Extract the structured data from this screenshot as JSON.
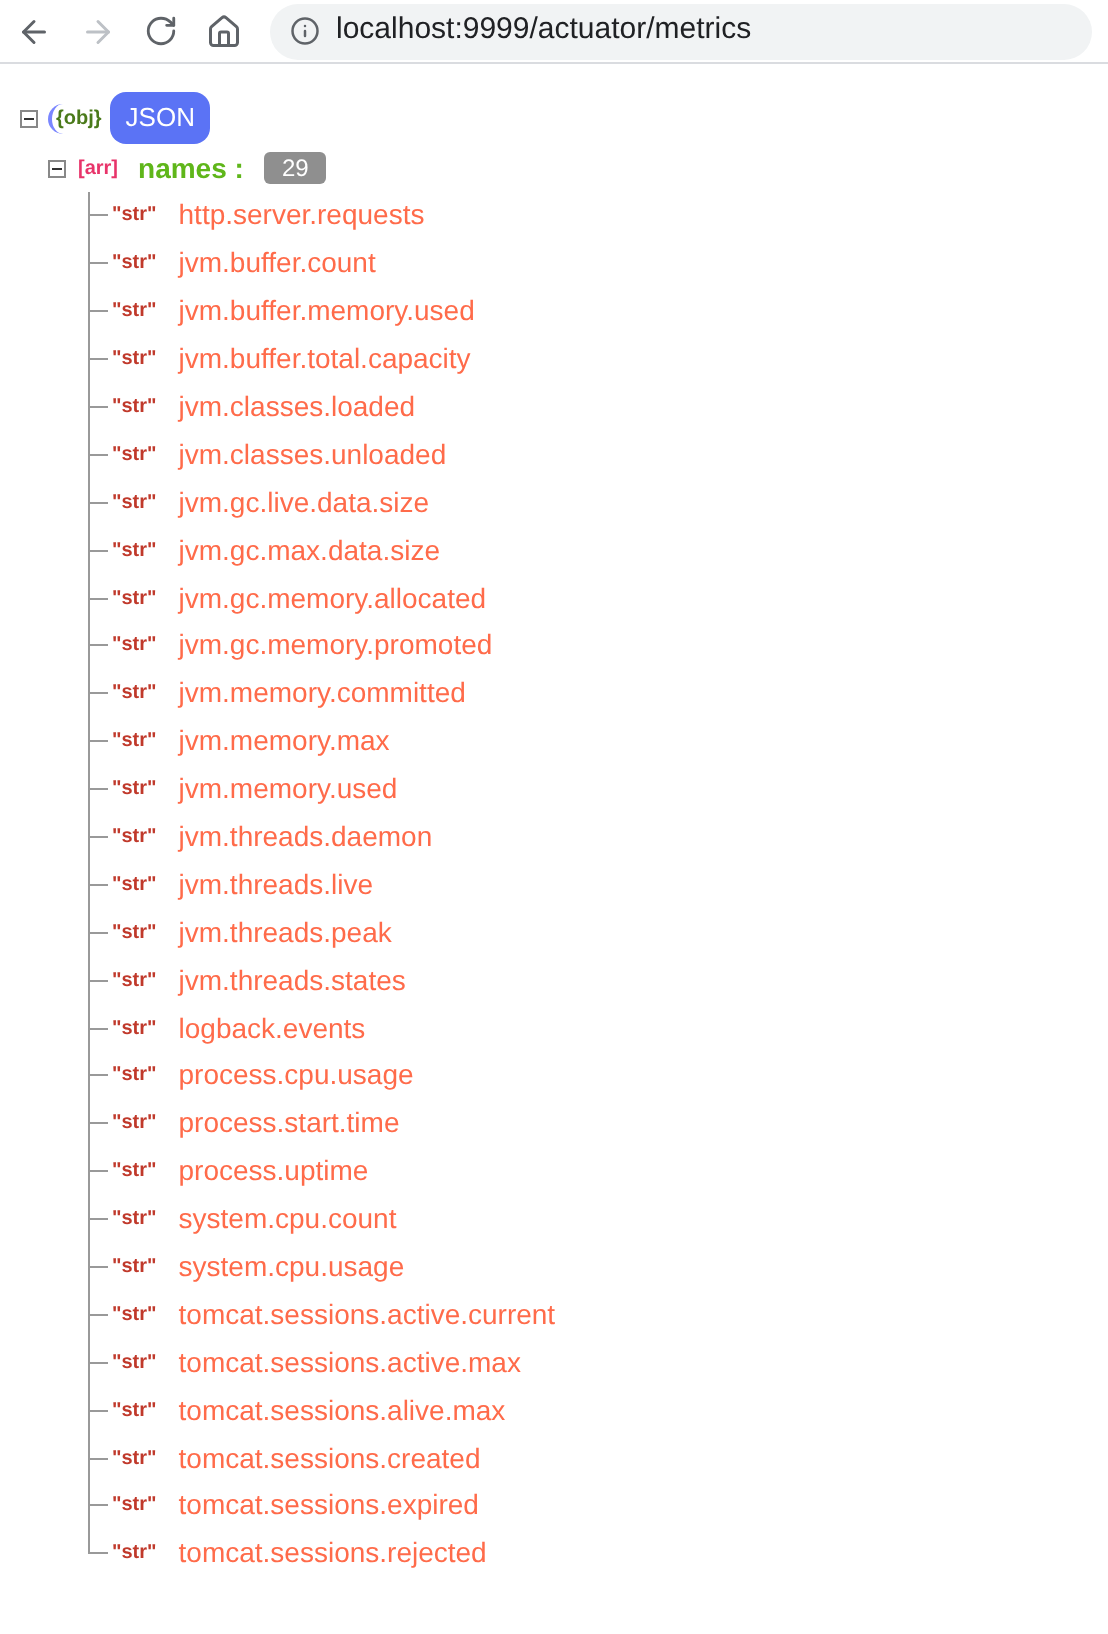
{
  "browser": {
    "url": "localhost:9999/actuator/metrics"
  },
  "tree": {
    "type_tag": "{obj}",
    "label": "JSON",
    "expanded": true,
    "children": [
      {
        "type_tag": "[arr]",
        "key": "names :",
        "count": "29",
        "expanded": true,
        "children": [
          {
            "type_tag": "\"str\"",
            "value": "http.server.requests"
          },
          {
            "type_tag": "\"str\"",
            "value": "jvm.buffer.count"
          },
          {
            "type_tag": "\"str\"",
            "value": "jvm.buffer.memory.used"
          },
          {
            "type_tag": "\"str\"",
            "value": "jvm.buffer.total.capacity"
          },
          {
            "type_tag": "\"str\"",
            "value": "jvm.classes.loaded"
          },
          {
            "type_tag": "\"str\"",
            "value": "jvm.classes.unloaded"
          },
          {
            "type_tag": "\"str\"",
            "value": "jvm.gc.live.data.size"
          },
          {
            "type_tag": "\"str\"",
            "value": "jvm.gc.max.data.size"
          },
          {
            "type_tag": "\"str\"",
            "value": "jvm.gc.memory.allocated"
          },
          {
            "type_tag": "\"str\"",
            "value": "jvm.gc.memory.promoted"
          },
          {
            "type_tag": "\"str\"",
            "value": "jvm.memory.committed"
          },
          {
            "type_tag": "\"str\"",
            "value": "jvm.memory.max"
          },
          {
            "type_tag": "\"str\"",
            "value": "jvm.memory.used"
          },
          {
            "type_tag": "\"str\"",
            "value": "jvm.threads.daemon"
          },
          {
            "type_tag": "\"str\"",
            "value": "jvm.threads.live"
          },
          {
            "type_tag": "\"str\"",
            "value": "jvm.threads.peak"
          },
          {
            "type_tag": "\"str\"",
            "value": "jvm.threads.states"
          },
          {
            "type_tag": "\"str\"",
            "value": "logback.events"
          },
          {
            "type_tag": "\"str\"",
            "value": "process.cpu.usage"
          },
          {
            "type_tag": "\"str\"",
            "value": "process.start.time"
          },
          {
            "type_tag": "\"str\"",
            "value": "process.uptime"
          },
          {
            "type_tag": "\"str\"",
            "value": "system.cpu.count"
          },
          {
            "type_tag": "\"str\"",
            "value": "system.cpu.usage"
          },
          {
            "type_tag": "\"str\"",
            "value": "tomcat.sessions.active.current"
          },
          {
            "type_tag": "\"str\"",
            "value": "tomcat.sessions.active.max"
          },
          {
            "type_tag": "\"str\"",
            "value": "tomcat.sessions.alive.max"
          },
          {
            "type_tag": "\"str\"",
            "value": "tomcat.sessions.created"
          },
          {
            "type_tag": "\"str\"",
            "value": "tomcat.sessions.expired"
          },
          {
            "type_tag": "\"str\"",
            "value": "tomcat.sessions.rejected"
          }
        ]
      }
    ]
  }
}
